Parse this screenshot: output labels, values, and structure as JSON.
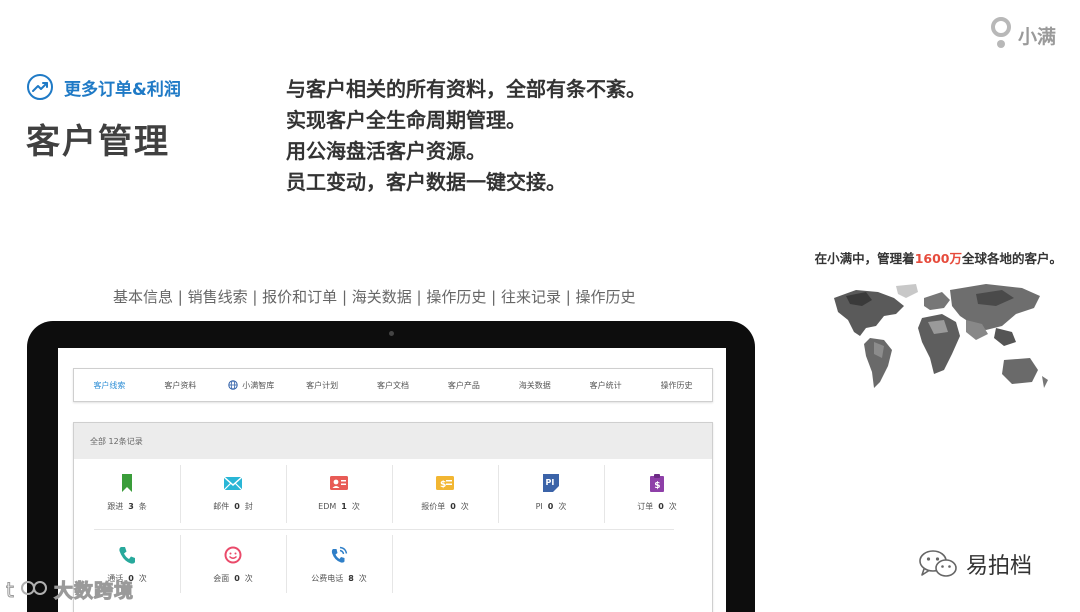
{
  "brand": {
    "logo_text": "小满"
  },
  "hero": {
    "eyebrow": "更多订单&利润",
    "title": "客户管理",
    "lines": [
      "与客户相关的所有资料，全部有条不紊。",
      "实现客户全生命周期管理。",
      "用公海盘活客户资源。",
      "员工变动，客户数据一键交接。"
    ]
  },
  "caption": "基本信息 | 销售线索 | 报价和订单 | 海关数据 | 操作历史 | 往来记录 | 操作历史",
  "world": {
    "prefix": "在小满中，管理着",
    "highlight": "1600万",
    "suffix": "全球各地的客户。"
  },
  "app": {
    "tabs": [
      {
        "label": "客户线索",
        "active": true
      },
      {
        "label": "客户资料"
      },
      {
        "label": "小满智库"
      },
      {
        "label": "客户计划"
      },
      {
        "label": "客户文档"
      },
      {
        "label": "客户产品"
      },
      {
        "label": "海关数据"
      },
      {
        "label": "客户统计"
      },
      {
        "label": "操作历史"
      }
    ],
    "panel_title": "全部 12条记录",
    "stats": [
      {
        "name": "跟进",
        "count": "3",
        "unit": "条",
        "icon": "bookmark-icon",
        "color": "#3a9d3a"
      },
      {
        "name": "邮件",
        "count": "0",
        "unit": "封",
        "icon": "mail-icon",
        "color": "#29b6d6"
      },
      {
        "name": "EDM",
        "count": "1",
        "unit": "次",
        "icon": "edm-card-icon",
        "color": "#e85b56"
      },
      {
        "name": "报价单",
        "count": "0",
        "unit": "次",
        "icon": "quote-icon",
        "color": "#f2b632"
      },
      {
        "name": "PI",
        "count": "0",
        "unit": "次",
        "icon": "pi-doc-icon",
        "color": "#3b63a8"
      },
      {
        "name": "订单",
        "count": "0",
        "unit": "次",
        "icon": "order-clipboard-icon",
        "color": "#8e3fa8"
      },
      {
        "name": "通话",
        "count": "0",
        "unit": "次",
        "icon": "phone-icon",
        "color": "#28a99c"
      },
      {
        "name": "会面",
        "count": "0",
        "unit": "次",
        "icon": "smile-icon",
        "color": "#ea4a6a"
      },
      {
        "name": "公费电话",
        "count": "8",
        "unit": "次",
        "icon": "call-icon",
        "color": "#2f7fc8"
      }
    ]
  },
  "watermarks": {
    "left": "大数跨境",
    "right": "易拍档"
  },
  "colors": {
    "accent": "#1f7ac6",
    "tab_active": "#2f8fd6",
    "highlight": "#e64b3c"
  }
}
